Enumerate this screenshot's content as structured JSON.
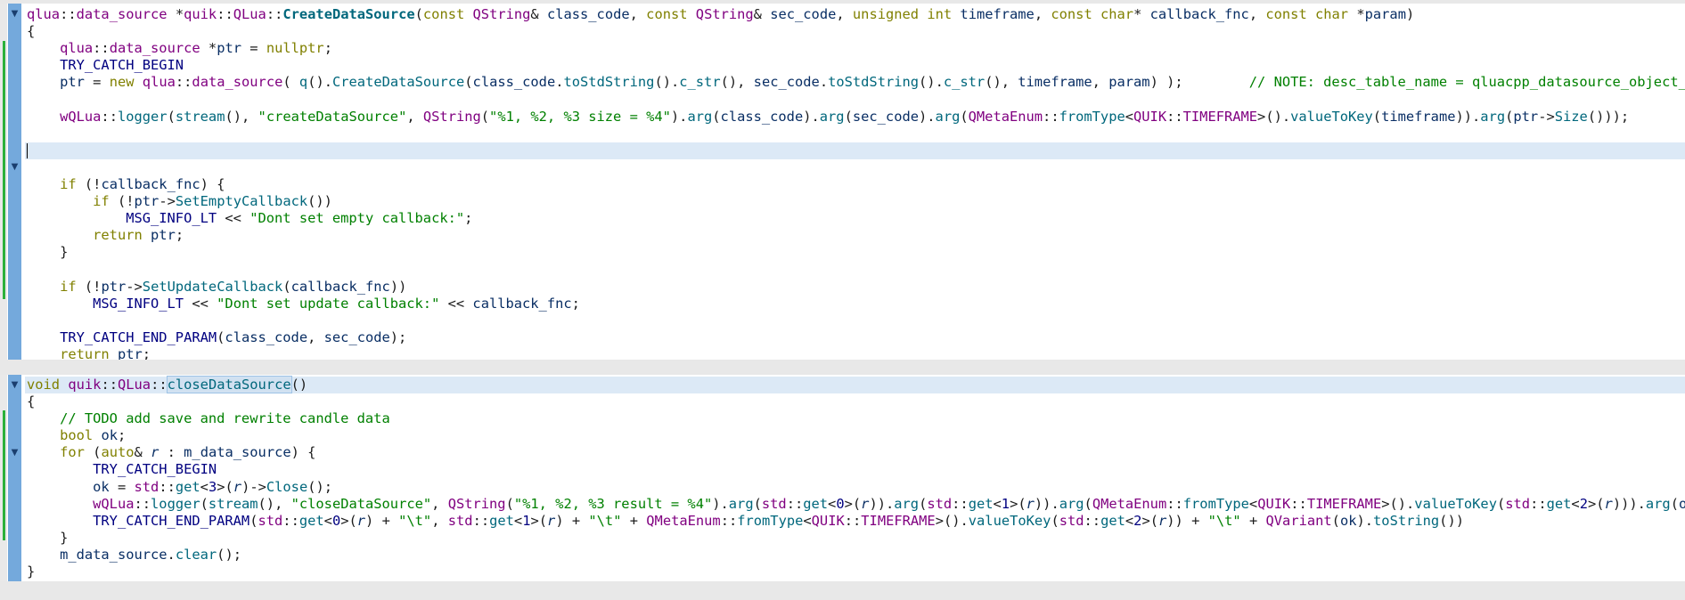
{
  "panes": [
    {
      "id": "create",
      "lines": [
        "qlua::data_source *quik::QLua::CreateDataSource(const QString& class_code, const QString& sec_code, unsigned int timeframe, const char* callback_fnc, const char *param)",
        "{",
        "    qlua::data_source *ptr = nullptr;",
        "    TRY_CATCH_BEGIN",
        "    ptr = new qlua::data_source( q().CreateDataSource(class_code.toStdString().c_str(), sec_code.toStdString().c_str(), timeframe, param) );        // NOTE: desc_table_name = qluacpp_datasource_object_refs",
        "",
        "    wQLua::logger(stream(), \"createDataSource\", QString(\"%1, %2, %3 size = %4\").arg(class_code).arg(sec_code).arg(QMetaEnum::fromType<QUIK::TIMEFRAME>().valueToKey(timeframe)).arg(ptr->Size()));",
        "",
        "",
        "",
        "    if (!callback_fnc) {",
        "        if (!ptr->SetEmptyCallback())",
        "            MSG_INFO_LT << \"Dont set empty callback:\";",
        "        return ptr;",
        "    }",
        "",
        "    if (!ptr->SetUpdateCallback(callback_fnc))",
        "        MSG_INFO_LT << \"Dont set update callback:\" << callback_fnc;",
        "",
        "    TRY_CATCH_END_PARAM(class_code, sec_code);",
        "    return ptr;",
        "}"
      ]
    },
    {
      "id": "close",
      "lines": [
        "void quik::QLua::closeDataSource()",
        "{",
        "    // TODO add save and rewrite candle data",
        "    bool ok;",
        "    for (auto& r : m_data_source) {",
        "        TRY_CATCH_BEGIN",
        "        ok = std::get<3>(r)->Close();",
        "        wQLua::logger(stream(), \"closeDataSource\", QString(\"%1, %2, %3 result = %4\").arg(std::get<0>(r)).arg(std::get<1>(r)).arg(QMetaEnum::fromType<QUIK::TIMEFRAME>().valueToKey(std::get<2>(r))).arg(ok));",
        "        TRY_CATCH_END_PARAM(std::get<0>(r) + \"\\t\", std::get<1>(r) + \"\\t\" + QMetaEnum::fromType<QUIK::TIMEFRAME>().valueToKey(std::get<2>(r)) + \"\\t\" + QVariant(ok).toString())",
        "    }",
        "    m_data_source.clear();",
        "}"
      ]
    }
  ],
  "fold_icon": "triangle-down-icon",
  "colors": {
    "gutter": "#74a9dc",
    "current_line": "#dce9f6",
    "change_bar": "#2bb13a",
    "keyword": "#808000",
    "type": "#800080",
    "function": "#00677c",
    "string": "#008000",
    "macro": "#000080"
  }
}
